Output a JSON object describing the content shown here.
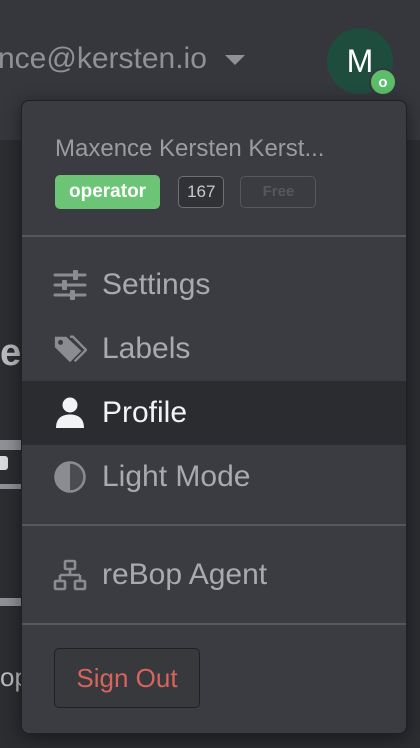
{
  "header": {
    "account_email": "nce@kersten.io",
    "avatar_initial": "M",
    "avatar_badge": "o"
  },
  "background": {
    "heading_fragment": "e",
    "text_fragment": "op"
  },
  "menu": {
    "user_name": "Maxence Kersten Kerst...",
    "role_badge": "operator",
    "count_badge": "167",
    "plan_badge": "Free",
    "items": [
      {
        "label": "Settings",
        "icon": "sliders-icon"
      },
      {
        "label": "Labels",
        "icon": "tags-icon"
      },
      {
        "label": "Profile",
        "icon": "user-icon",
        "active": true
      },
      {
        "label": "Light Mode",
        "icon": "half-circle-icon"
      },
      {
        "label": "reBop Agent",
        "icon": "network-icon"
      }
    ],
    "sign_out_label": "Sign Out"
  },
  "colors": {
    "role_badge": "#6cc576",
    "sign_out_text": "#d9635d",
    "avatar": "#1e4d3e"
  }
}
